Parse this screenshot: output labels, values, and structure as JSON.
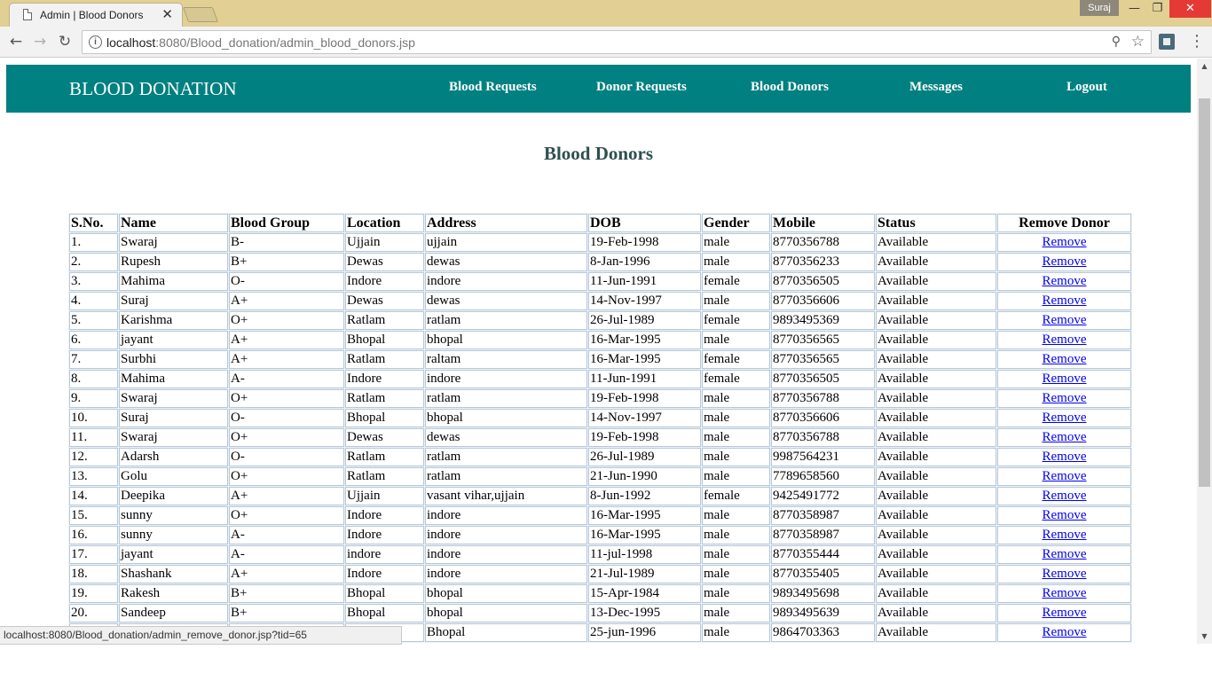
{
  "browser": {
    "tab_title": "Admin | Blood Donors",
    "tab_close": "✕",
    "user": "Suraj",
    "url_host": "localhost",
    "url_path": ":8080/Blood_donation/admin_blood_donors.jsp",
    "status_url": "localhost:8080/Blood_donation/admin_remove_donor.jsp?tid=65"
  },
  "header": {
    "brand": "BLOOD DONATION",
    "nav": [
      "Blood Requests",
      "Donor Requests",
      "Blood Donors",
      "Messages",
      "Logout"
    ]
  },
  "page": {
    "title": "Blood Donors"
  },
  "table": {
    "columns": [
      "S.No.",
      "Name",
      "Blood Group",
      "Location",
      "Address",
      "DOB",
      "Gender",
      "Mobile",
      "Status",
      "Remove Donor"
    ],
    "action_label": "Remove",
    "rows": [
      [
        "1.",
        "Swaraj",
        "B-",
        "Ujjain",
        "ujjain",
        "19-Feb-1998",
        "male",
        "8770356788",
        "Available"
      ],
      [
        "2.",
        "Rupesh",
        "B+",
        "Dewas",
        "dewas",
        "8-Jan-1996",
        "male",
        "8770356233",
        "Available"
      ],
      [
        "3.",
        "Mahima",
        "O-",
        "Indore",
        "indore",
        "11-Jun-1991",
        "female",
        "8770356505",
        "Available"
      ],
      [
        "4.",
        "Suraj",
        "A+",
        "Dewas",
        "dewas",
        "14-Nov-1997",
        "male",
        "8770356606",
        "Available"
      ],
      [
        "5.",
        "Karishma",
        "O+",
        "Ratlam",
        "ratlam",
        "26-Jul-1989",
        "female",
        "9893495369",
        "Available"
      ],
      [
        "6.",
        "jayant",
        "A+",
        "Bhopal",
        "bhopal",
        "16-Mar-1995",
        "male",
        "8770356565",
        "Available"
      ],
      [
        "7.",
        "Surbhi",
        "A+",
        "Ratlam",
        "raltam",
        "16-Mar-1995",
        "female",
        "8770356565",
        "Available"
      ],
      [
        "8.",
        "Mahima",
        "A-",
        "Indore",
        "indore",
        "11-Jun-1991",
        "female",
        "8770356505",
        "Available"
      ],
      [
        "9.",
        "Swaraj",
        "O+",
        "Ratlam",
        "ratlam",
        "19-Feb-1998",
        "male",
        "8770356788",
        "Available"
      ],
      [
        "10.",
        "Suraj",
        "O-",
        "Bhopal",
        "bhopal",
        "14-Nov-1997",
        "male",
        "8770356606",
        "Available"
      ],
      [
        "11.",
        "Swaraj",
        "O+",
        "Dewas",
        "dewas",
        "19-Feb-1998",
        "male",
        "8770356788",
        "Available"
      ],
      [
        "12.",
        "Adarsh",
        "O-",
        "Ratlam",
        "ratlam",
        "26-Jul-1989",
        "male",
        "9987564231",
        "Available"
      ],
      [
        "13.",
        "Golu",
        "O+",
        "Ratlam",
        "ratlam",
        "21-Jun-1990",
        "male",
        "7789658560",
        "Available"
      ],
      [
        "14.",
        "Deepika",
        "A+",
        "Ujjain",
        "vasant vihar,ujjain",
        "8-Jun-1992",
        "female",
        "9425491772",
        "Available"
      ],
      [
        "15.",
        "sunny",
        "O+",
        "Indore",
        "indore",
        "16-Mar-1995",
        "male",
        "8770358987",
        "Available"
      ],
      [
        "16.",
        "sunny",
        "A-",
        "Indore",
        "indore",
        "16-Mar-1995",
        "male",
        "8770358987",
        "Available"
      ],
      [
        "17.",
        "jayant",
        "A-",
        "indore",
        "indore",
        "11-jul-1998",
        "male",
        "8770355444",
        "Available"
      ],
      [
        "18.",
        "Shashank",
        "A+",
        "Indore",
        "indore",
        "21-Jul-1989",
        "male",
        "8770355405",
        "Available"
      ],
      [
        "19.",
        "Rakesh",
        "B+",
        "Bhopal",
        "bhopal",
        "15-Apr-1984",
        "male",
        "9893495698",
        "Available"
      ],
      [
        "20.",
        "Sandeep",
        "B+",
        "Bhopal",
        "bhopal",
        "13-Dec-1995",
        "male",
        "9893495639",
        "Available"
      ],
      [
        "",
        "",
        "",
        "",
        "Bhopal",
        "25-jun-1996",
        "male",
        "9864703363",
        "Available"
      ]
    ]
  },
  "colors": {
    "header_bg": "#008080",
    "title_color": "#2f4f4f",
    "link_color": "#0000ee",
    "titlebar_bg": "#e2cf94"
  },
  "icons": [
    "page-icon",
    "back-icon",
    "forward-icon",
    "reload-icon",
    "info-icon",
    "zoom-icon",
    "star-icon",
    "extension-icon",
    "menu-icon"
  ]
}
